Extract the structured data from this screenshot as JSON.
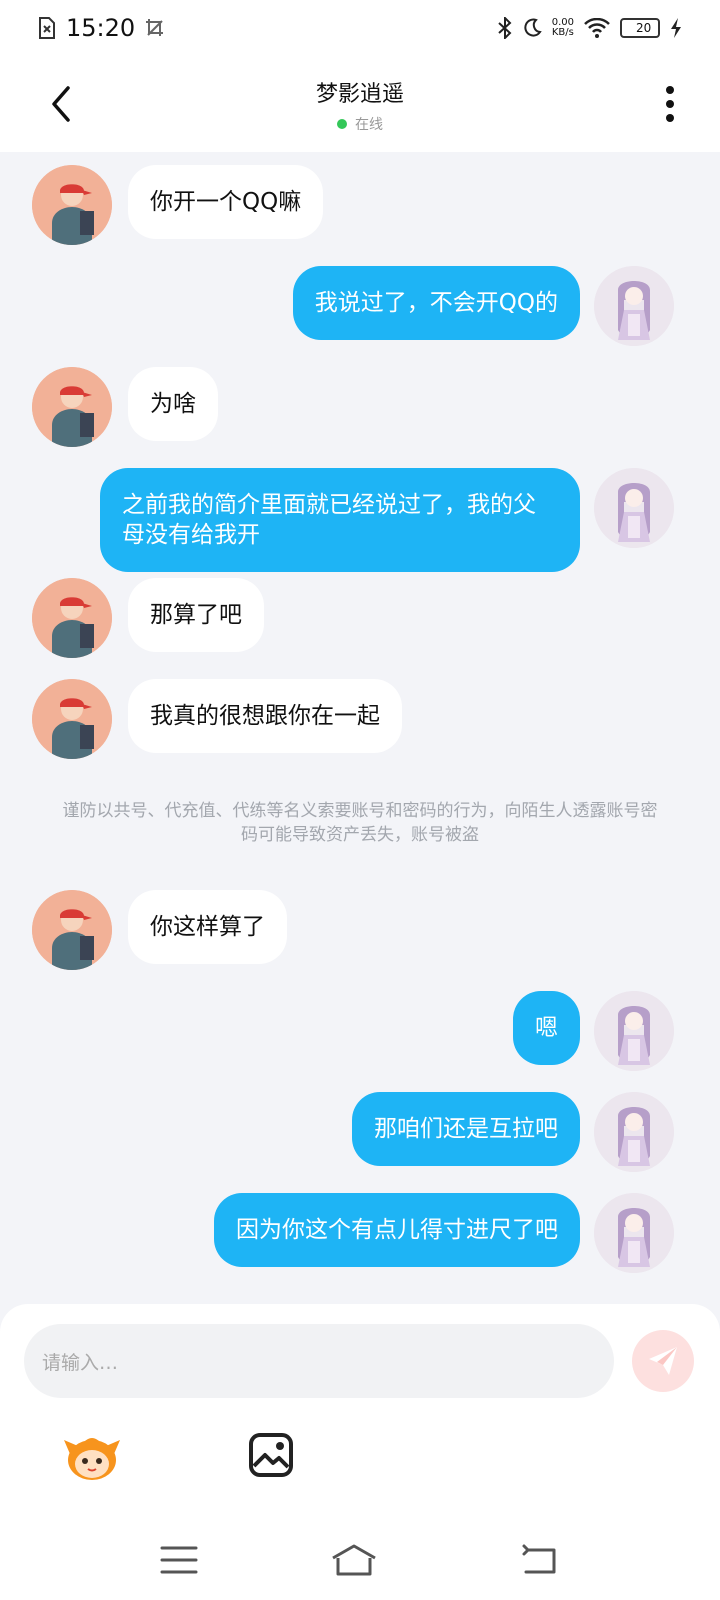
{
  "status_bar": {
    "time": "15:20",
    "net_speed_value": "0.00",
    "net_speed_unit": "KB/s",
    "battery_level": "20",
    "battery_fraction": 0.2
  },
  "header": {
    "title": "梦影逍遥",
    "presence": "在线"
  },
  "messages": [
    {
      "from": "other",
      "text": "你开一个QQ嘛"
    },
    {
      "from": "self",
      "text": "我说过了，不会开QQ的"
    },
    {
      "from": "other",
      "text": "为啥"
    },
    {
      "from": "self",
      "text": "之前我的简介里面就已经说过了，我的父母没有给我开"
    },
    {
      "from": "other",
      "text": "那算了吧"
    },
    {
      "from": "other",
      "text": "我真的很想跟你在一起"
    },
    {
      "from": "other",
      "text": "你这样算了"
    },
    {
      "from": "self",
      "text": "嗯"
    },
    {
      "from": "self",
      "text": "那咱们还是互拉吧"
    },
    {
      "from": "self",
      "text": "因为你这个有点儿得寸进尺了吧"
    }
  ],
  "system_tip": "谨防以共号、代充值、代练等名义索要账号和密码的行为，向陌生人透露账号密码可能导致资产丢失，账号被盗",
  "input": {
    "placeholder": "请输入…"
  },
  "colors": {
    "self_bubble": "#1eb4f5",
    "other_bubble": "#ffffff",
    "online": "#34c759",
    "send_button": "#fde0df"
  }
}
